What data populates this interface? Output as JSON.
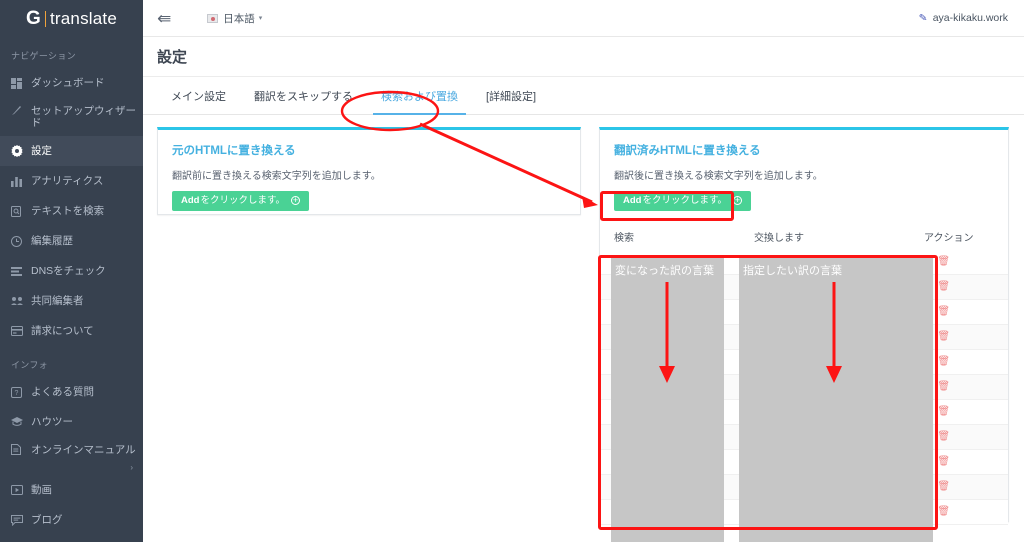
{
  "sidebar": {
    "brand": {
      "g": "G",
      "word": "translate"
    },
    "nav_heading": "ナビゲーション",
    "info_heading": "インフォ",
    "items": [
      {
        "label": "ダッシュボード",
        "icon": "dashboard-icon"
      },
      {
        "label": "セットアップウィザード",
        "icon": "wizard-icon"
      },
      {
        "label": "設定",
        "icon": "gear-icon"
      },
      {
        "label": "アナリティクス",
        "icon": "analytics-icon"
      },
      {
        "label": "テキストを検索",
        "icon": "document-search-icon"
      },
      {
        "label": "編集履歴",
        "icon": "history-icon"
      },
      {
        "label": "DNSをチェック",
        "icon": "dns-icon"
      },
      {
        "label": "共同編集者",
        "icon": "collaborators-icon"
      },
      {
        "label": "請求について",
        "icon": "billing-icon"
      }
    ],
    "info_items": [
      {
        "label": "よくある質問",
        "icon": "faq-icon"
      },
      {
        "label": "ハウツー",
        "icon": "howto-icon"
      },
      {
        "label": "オンラインマニュアル",
        "icon": "manual-icon"
      },
      {
        "label": "動画",
        "icon": "video-icon"
      },
      {
        "label": "ブログ",
        "icon": "blog-icon"
      }
    ]
  },
  "topbar": {
    "collapse_icon": "collapse-sidebar-icon",
    "language": "日本語",
    "caret": "▾",
    "account": "aya-kikaku.work",
    "account_icon": "pen-icon"
  },
  "page": {
    "title": "設定",
    "tabs": [
      {
        "label": "メイン設定",
        "active": false
      },
      {
        "label": "翻訳をスキップする",
        "active": false
      },
      {
        "label": "検索および置換",
        "active": true
      },
      {
        "label": "[詳細設定]",
        "active": false
      }
    ]
  },
  "left_card": {
    "title": "元のHTMLに置き換える",
    "description": "翻訳前に置き換える検索文字列を追加します。",
    "button": {
      "bold": "Add",
      "rest": "をクリックします。",
      "icon": "plus-circle-icon"
    }
  },
  "right_card": {
    "title": "翻訳済みHTMLに置き換える",
    "description": "翻訳後に置き換える検索文字列を追加します。",
    "button": {
      "bold": "Add",
      "rest": "をクリックします。",
      "icon": "plus-circle-icon"
    },
    "table": {
      "columns": {
        "search": "検索",
        "replace": "交換します",
        "action": "アクション"
      },
      "rows": [
        {
          "search": "",
          "replace": "",
          "edit_icon": "pencil-icon",
          "delete_icon": "trash-icon"
        },
        {
          "search": "",
          "replace": "",
          "edit_icon": "pencil-icon",
          "delete_icon": "trash-icon"
        },
        {
          "search": "",
          "replace": "",
          "edit_icon": "pencil-icon",
          "delete_icon": "trash-icon"
        },
        {
          "search": "",
          "replace": "",
          "edit_icon": "pencil-icon",
          "delete_icon": "trash-icon"
        },
        {
          "search": "",
          "replace": "",
          "edit_icon": "pencil-icon",
          "delete_icon": "trash-icon"
        },
        {
          "search": "",
          "replace": "",
          "edit_icon": "pencil-icon",
          "delete_icon": "trash-icon"
        },
        {
          "search": "",
          "replace": "",
          "edit_icon": "pencil-icon",
          "delete_icon": "trash-icon"
        },
        {
          "search": "",
          "replace": "",
          "edit_icon": "pencil-icon",
          "delete_icon": "trash-icon"
        },
        {
          "search": "",
          "replace": "",
          "edit_icon": "pencil-icon",
          "delete_icon": "trash-icon"
        },
        {
          "search": "",
          "replace": "",
          "edit_icon": "pencil-icon",
          "delete_icon": "trash-icon"
        },
        {
          "search": "",
          "replace": "",
          "edit_icon": "pencil-icon",
          "delete_icon": "trash-icon"
        }
      ]
    }
  },
  "annotations": {
    "search_column_note": "変になった訳の言葉",
    "replace_column_note": "指定したい訳の言葉",
    "accent_red": "#fc1414",
    "overlay_gray": "#c6c6c6"
  },
  "colors": {
    "sidebar_bg": "#37414f",
    "card_accent": "#2bc5e8",
    "add_button": "#4ad295",
    "tab_active": "#49a8e0",
    "edit_icon": "#3f7fe0",
    "delete_icon": "#f08a8a"
  }
}
